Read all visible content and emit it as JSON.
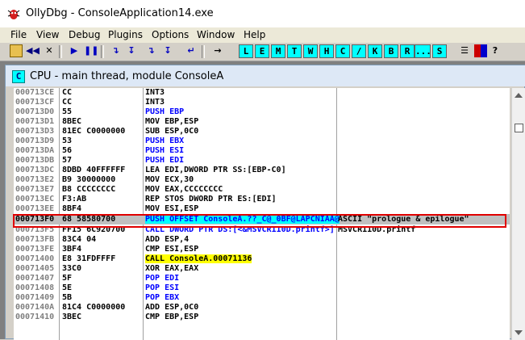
{
  "window": {
    "title": "OllyDbg - ConsoleApplication14.exe"
  },
  "menu": [
    "File",
    "View",
    "Debug",
    "Plugins",
    "Options",
    "Window",
    "Help"
  ],
  "toolbar": {
    "buttons": [
      "open",
      "rewind",
      "close",
      "run",
      "pause",
      "step-into",
      "step-over",
      "trace-into",
      "trace-over",
      "execute-till-return",
      "go-to"
    ],
    "letters": [
      "L",
      "E",
      "M",
      "T",
      "W",
      "H",
      "C",
      "/",
      "K",
      "B",
      "R",
      "...",
      "S"
    ]
  },
  "cpu": {
    "icon_letter": "C",
    "title": "CPU - main thread, module ConsoleA"
  },
  "disasm": [
    {
      "addr": "000713CE",
      "hex": "CC",
      "op": "INT3"
    },
    {
      "addr": "000713CF",
      "hex": "CC",
      "op": "INT3"
    },
    {
      "addr": "000713D0",
      "hex": "55",
      "op": "PUSH EBP"
    },
    {
      "addr": "000713D1",
      "hex": "8BEC",
      "op": "MOV EBP,ESP"
    },
    {
      "addr": "000713D3",
      "hex": "81EC C0000000",
      "op": "SUB ESP,0C0"
    },
    {
      "addr": "000713D9",
      "hex": "53",
      "op": "PUSH EBX"
    },
    {
      "addr": "000713DA",
      "hex": "56",
      "op": "PUSH ESI"
    },
    {
      "addr": "000713DB",
      "hex": "57",
      "op": "PUSH EDI"
    },
    {
      "addr": "000713DC",
      "hex": "8DBD 40FFFFFF",
      "op": "LEA EDI,DWORD PTR SS:[EBP-C0]"
    },
    {
      "addr": "000713E2",
      "hex": "B9 30000000",
      "op": "MOV ECX,30"
    },
    {
      "addr": "000713E7",
      "hex": "B8 CCCCCCCC",
      "op": "MOV EAX,CCCCCCCC"
    },
    {
      "addr": "000713EC",
      "hex": "F3:AB",
      "op": "REP STOS DWORD PTR ES:[EDI]"
    },
    {
      "addr": "000713EE",
      "hex": "8BF4",
      "op": "MOV ESI,ESP"
    },
    {
      "addr": "000713F0",
      "hex": "68 58580700",
      "op": "PUSH OFFSET ConsoleA.??_C@_0BF@LAPCNIAA@",
      "comment": "ASCII \"prologue & epilogue\""
    },
    {
      "addr": "000713F5",
      "hex": "FF15 6C920700",
      "op": "CALL DWORD PTR DS:[<&MSVCR110D.printf>]",
      "comment": "MSVCR110D.printf"
    },
    {
      "addr": "000713FB",
      "hex": "83C4 04",
      "op": "ADD ESP,4"
    },
    {
      "addr": "000713FE",
      "hex": "3BF4",
      "op": "CMP ESI,ESP"
    },
    {
      "addr": "00071400",
      "hex": "E8 31FDFFFF",
      "op": "CALL ConsoleA.00071136"
    },
    {
      "addr": "00071405",
      "hex": "33C0",
      "op": "XOR EAX,EAX"
    },
    {
      "addr": "00071407",
      "hex": "5F",
      "op": "POP EDI"
    },
    {
      "addr": "00071408",
      "hex": "5E",
      "op": "POP ESI"
    },
    {
      "addr": "00071409",
      "hex": "5B",
      "op": "POP EBX"
    },
    {
      "addr": "0007140A",
      "hex": "81C4 C0000000",
      "op": "ADD ESP,0C0"
    },
    {
      "addr": "00071410",
      "hex": "3BEC",
      "op": "CMP EBP,ESP"
    }
  ],
  "colors": {
    "cyan": "#00ffff",
    "yellow": "#ffff00",
    "highlight_box": "#e00000",
    "olive_number": "#808000"
  }
}
